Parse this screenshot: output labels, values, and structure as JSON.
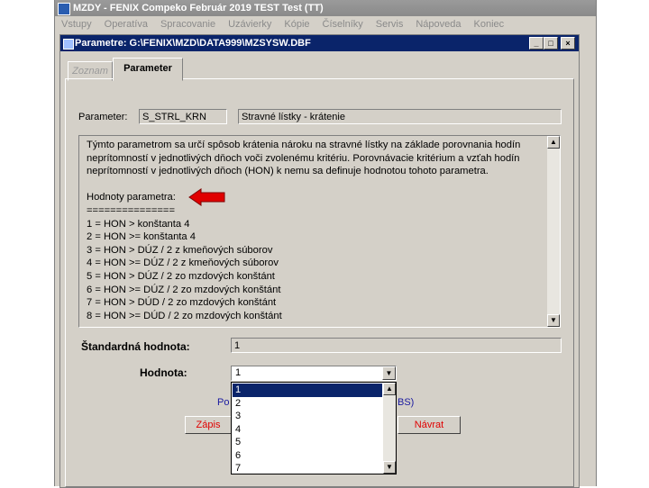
{
  "app": {
    "title": "MZDY - FENIX Compeko   Február 2019   TEST Test  (TT)",
    "menu": [
      "Vstupy",
      "Operatíva",
      "Spracovanie",
      "Uzávierky",
      "Kópie",
      "Číselníky",
      "Servis",
      "Nápoveda",
      "Koniec"
    ]
  },
  "window": {
    "title": "Parametre: G:\\FENIX\\MZD\\DATA999\\MZSYSW.DBF",
    "minimize": "_",
    "restore": "□",
    "close": "×"
  },
  "tabs": [
    "Zoznam",
    "Parameter"
  ],
  "form": {
    "parameter_label": "Parameter:",
    "parameter_code": "S_STRL_KRN",
    "parameter_name": "Stravné lístky - krátenie",
    "description_lines": [
      "Týmto parametrom sa určí spôsob krátenia nároku na stravné lístky na základe porovnania hodín",
      "neprítomností v jednotlivých dňoch voči zvolenému kritériu. Porovnávacie kritérium a vzťah hodín",
      "neprítomností v jednotlivých dňoch (HON) k nemu sa definuje hodnotou tohoto parametra.",
      "",
      "Hodnoty parametra:",
      "===============",
      "1 = HON >   konštanta 4",
      "2 = HON >= konštanta 4",
      "3 = HON >   DÚZ / 2 z kmeňových súborov",
      "4 = HON >= DÚZ / 2 z kmeňových súborov",
      "5 = HON >   DÚZ / 2 zo mzdových konštánt",
      "6 = HON >= DÚZ / 2 zo mzdových konštánt",
      "7 = HON >   DÚD / 2 zo mzdových konštánt",
      "8 = HON >= DÚD / 2 zo mzdových konštánt"
    ],
    "standard_label": "Štandardná hodnota:",
    "standard_value": "1",
    "value_label": "Hodnota:",
    "value_selected": "1",
    "value_options": [
      "1",
      "2",
      "3",
      "4",
      "5",
      "6",
      "7"
    ],
    "hidden_text_left": "Po",
    "hidden_text_right": "BS)",
    "save_button": "Zápis",
    "back_button": "Návrat"
  },
  "colors": {
    "titlebar_active": "#0a246a",
    "titlebar_inactive": "#8a8a8a",
    "dialog_face": "#d4d0c8",
    "accent_red": "#e00000",
    "link_blue": "#1a1aa0"
  }
}
